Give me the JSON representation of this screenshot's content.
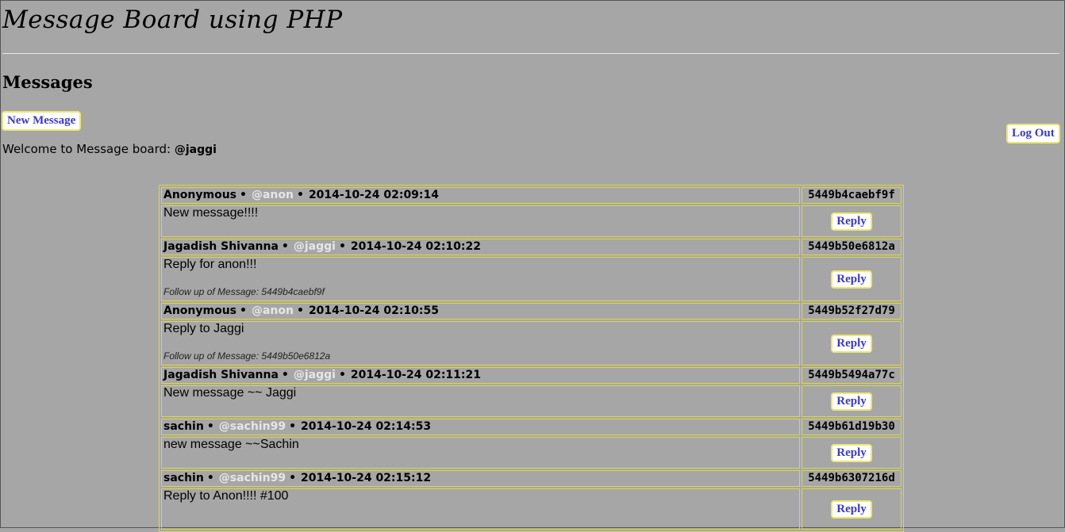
{
  "header": {
    "title": "Message Board using PHP",
    "section_title": "Messages"
  },
  "actions": {
    "new_message": "New Message",
    "log_out": "Log Out",
    "reply": "Reply"
  },
  "welcome": {
    "text": "Welcome to Message board: ",
    "user": "@jaggi"
  },
  "messages": [
    {
      "name": "Anonymous",
      "handle": "@anon",
      "timestamp": "2014-10-24 02:09:14",
      "id": "5449b4caebf9f",
      "text": "New message!!!!",
      "followup": ""
    },
    {
      "name": "Jagadish Shivanna",
      "handle": "@jaggi",
      "timestamp": "2014-10-24 02:10:22",
      "id": "5449b50e6812a",
      "text": "Reply for anon!!!",
      "followup": "Follow up of Message: 5449b4caebf9f"
    },
    {
      "name": "Anonymous",
      "handle": "@anon",
      "timestamp": "2014-10-24 02:10:55",
      "id": "5449b52f27d79",
      "text": "Reply to Jaggi",
      "followup": "Follow up of Message: 5449b50e6812a"
    },
    {
      "name": "Jagadish Shivanna",
      "handle": "@jaggi",
      "timestamp": "2014-10-24 02:11:21",
      "id": "5449b5494a77c",
      "text": "New message ~~ Jaggi",
      "followup": ""
    },
    {
      "name": "sachin",
      "handle": "@sachin99",
      "timestamp": "2014-10-24 02:14:53",
      "id": "5449b61d19b30",
      "text": "new message ~~Sachin",
      "followup": ""
    },
    {
      "name": "sachin",
      "handle": "@sachin99",
      "timestamp": "2014-10-24 02:15:12",
      "id": "5449b6307216d",
      "text": "Reply to Anon!!!! #100",
      "followup": ""
    }
  ],
  "colors": {
    "background": "#a6a6a6",
    "border": "#d8d84a",
    "button_text": "#3a3ac8",
    "handle": "#e6e6e6"
  },
  "glyphs": {
    "separator": "•"
  }
}
